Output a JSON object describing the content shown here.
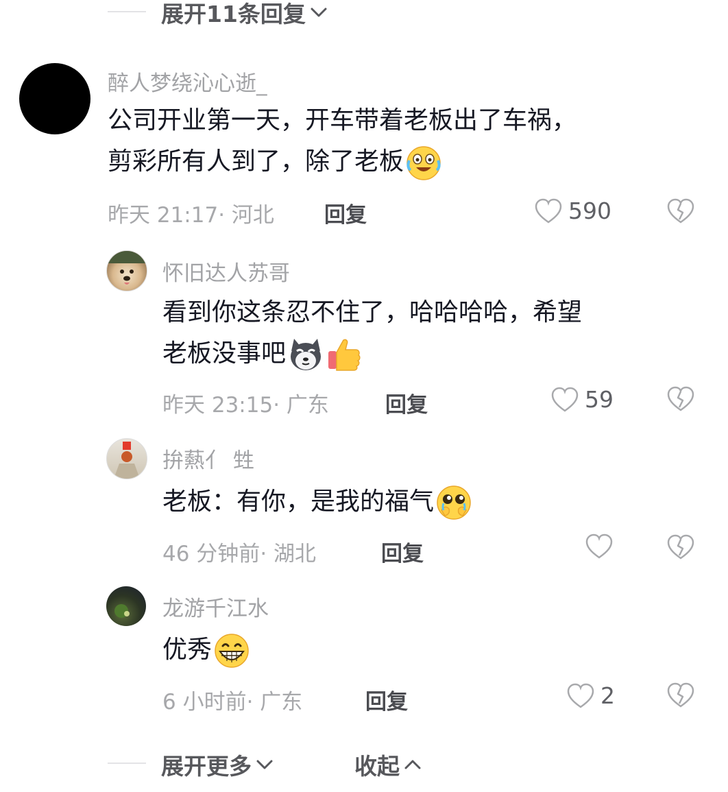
{
  "top_expand": {
    "label": "展开11条回复"
  },
  "main_comment": {
    "username": "醉人梦绕沁心逝_",
    "line1": "公司开业第一天，开车带着老板出了车祸，",
    "line2": "剪彩所有人到了，除了老板",
    "emoji": "crying-laugh-emoji",
    "time": "昨天 21:17",
    "location": "河北",
    "reply_label": "回复",
    "likes": "590"
  },
  "replies": [
    {
      "username": "怀旧达人苏哥",
      "line1": "看到你这条忍不住了，哈哈哈哈，希望",
      "line2": "老板没事吧",
      "emojis": [
        "husky-emoji",
        "thumbs-up-emoji"
      ],
      "time": "昨天 23:15",
      "location": "广东",
      "reply_label": "回复",
      "likes": "59"
    },
    {
      "username": "拚爇亻 甡",
      "line1": "老板：有你，是我的福气",
      "emojis": [
        "touched-tears-emoji"
      ],
      "time": "46 分钟前",
      "location": "湖北",
      "reply_label": "回复",
      "likes": ""
    },
    {
      "username": "龙游千江水",
      "line1": "优秀",
      "emojis": [
        "grin-emoji"
      ],
      "time": "6 小时前",
      "location": "广东",
      "reply_label": "回复",
      "likes": "2"
    }
  ],
  "bottom": {
    "expand_more": "展开更多",
    "collapse": "收起"
  },
  "meta_separator": "·"
}
